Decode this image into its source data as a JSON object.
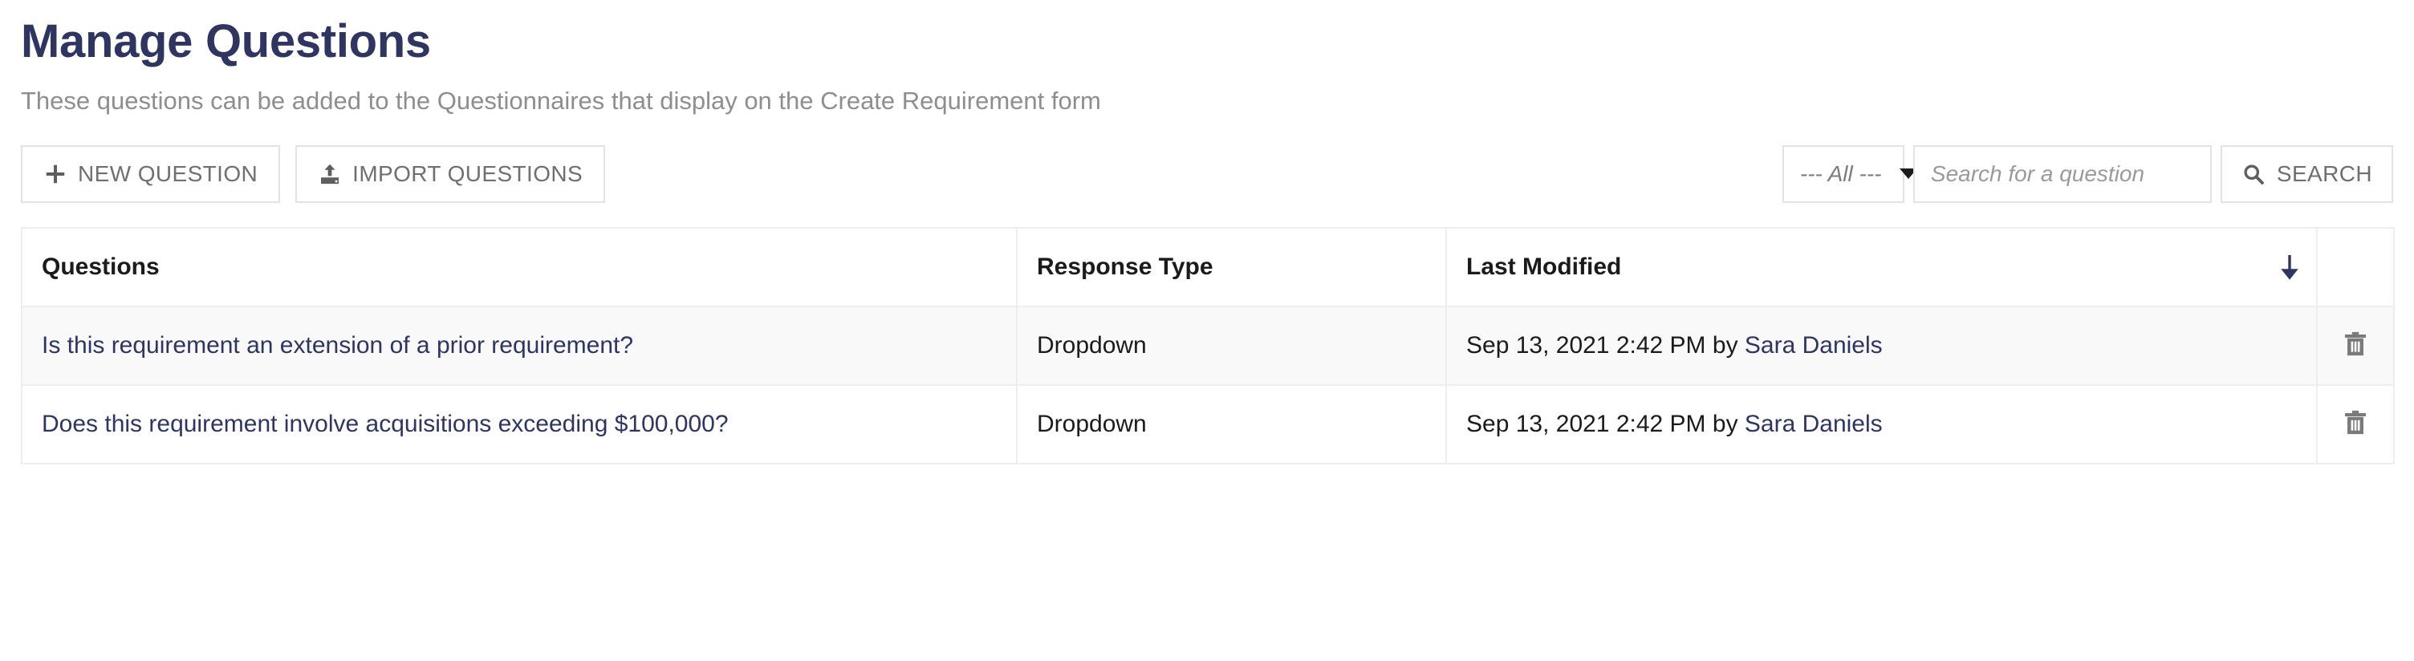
{
  "header": {
    "title": "Manage Questions",
    "subtitle": "These questions can be added to the Questionnaires that display on the Create Requirement form"
  },
  "toolbar": {
    "new_question_label": "NEW QUESTION",
    "new_question_icon": "plus-icon",
    "import_questions_label": "IMPORT QUESTIONS",
    "import_questions_icon": "upload-icon",
    "filter_select_value": "--- All ---",
    "filter_select_icon": "chevron-down-icon",
    "search_placeholder": "Search for a question",
    "search_value": "",
    "search_button_label": "SEARCH",
    "search_button_icon": "search-icon"
  },
  "table": {
    "columns": [
      {
        "key": "question",
        "label": "Questions"
      },
      {
        "key": "response_type",
        "label": "Response Type"
      },
      {
        "key": "last_modified",
        "label": "Last Modified"
      },
      {
        "key": "actions",
        "label": ""
      }
    ],
    "sort": {
      "column": "Last Modified",
      "direction": "descending",
      "icon": "arrow-down-icon"
    },
    "rows": [
      {
        "question": "Is this requirement an extension of a prior requirement?",
        "response_type": "Dropdown",
        "modified_prefix": "Sep 13, 2021 2:42 PM by ",
        "modified_user": "Sara Daniels",
        "delete_icon": "trash-icon"
      },
      {
        "question": "Does this requirement involve acquisitions exceeding $100,000?",
        "response_type": "Dropdown",
        "modified_prefix": "Sep 13, 2021 2:42 PM by ",
        "modified_user": "Sara Daniels",
        "delete_icon": "trash-icon"
      }
    ]
  },
  "colors": {
    "brand_navy": "#2e3560",
    "muted_text": "#8e8e8e",
    "border": "#e2e2e2",
    "row_stripe": "#f9f9f9"
  }
}
